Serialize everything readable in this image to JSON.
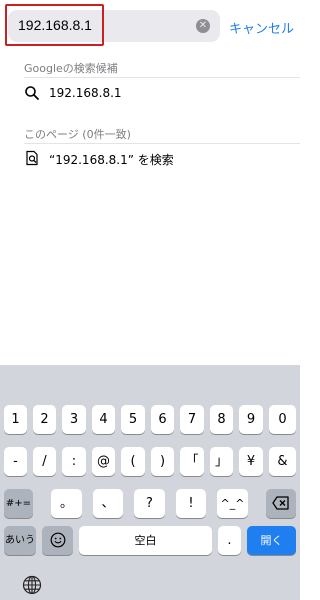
{
  "search": {
    "value": "192.168.8.1",
    "cancel_label": "キャンセル"
  },
  "suggestions": {
    "google_header": "Googleの検索候補",
    "google_item": "192.168.8.1",
    "page_header": "このページ (0件一致)",
    "page_item": "“192.168.8.1” を検索"
  },
  "keyboard": {
    "row1": [
      "1",
      "2",
      "3",
      "4",
      "5",
      "6",
      "7",
      "8",
      "9",
      "0"
    ],
    "row2": [
      "-",
      "/",
      ":",
      "@",
      "(",
      ")",
      "「",
      "」",
      "¥",
      "&"
    ],
    "row3": {
      "mode_key": "#+=",
      "keys": [
        "。",
        "、",
        "?",
        "!",
        "^_^"
      ],
      "backspace": "⌫"
    },
    "row4": {
      "kana_key": "あいう",
      "emoji_key": "☺",
      "space_label": "空白",
      "period_key": ".",
      "return_label": "開く"
    },
    "globe_icon": "globe-icon"
  },
  "colors": {
    "accent": "#1d80ea",
    "highlight": "#cc1f1f",
    "return_key": "#1f7ef0"
  }
}
